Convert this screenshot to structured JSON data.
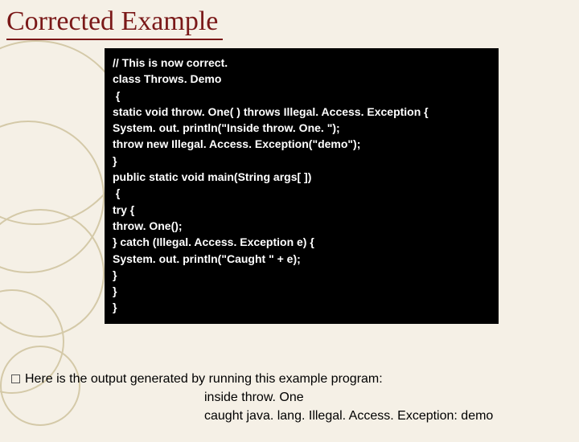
{
  "title": "Corrected Example",
  "code": {
    "l0": "// This is now correct.",
    "l1": "class Throws. Demo",
    "l2": " {",
    "l3": "static void throw. One( ) throws Illegal. Access. Exception {",
    "l4": "System. out. println(\"Inside throw. One. \");",
    "l5": "throw new Illegal. Access. Exception(\"demo\");",
    "l6": "}",
    "l7": "public static void main(String args[ ])",
    "l8": " {",
    "l9": "try {",
    "l10": "throw. One();",
    "l11": "} catch (Illegal. Access. Exception e) {",
    "l12": "System. out. println(\"Caught \" + e);",
    "l13": "}",
    "l14": "}",
    "l15": "}"
  },
  "footer": {
    "intro": "Here is the output generated by running this example program:",
    "out1": "inside throw. One",
    "out2": "caught java. lang. Illegal. Access. Exception: demo"
  }
}
